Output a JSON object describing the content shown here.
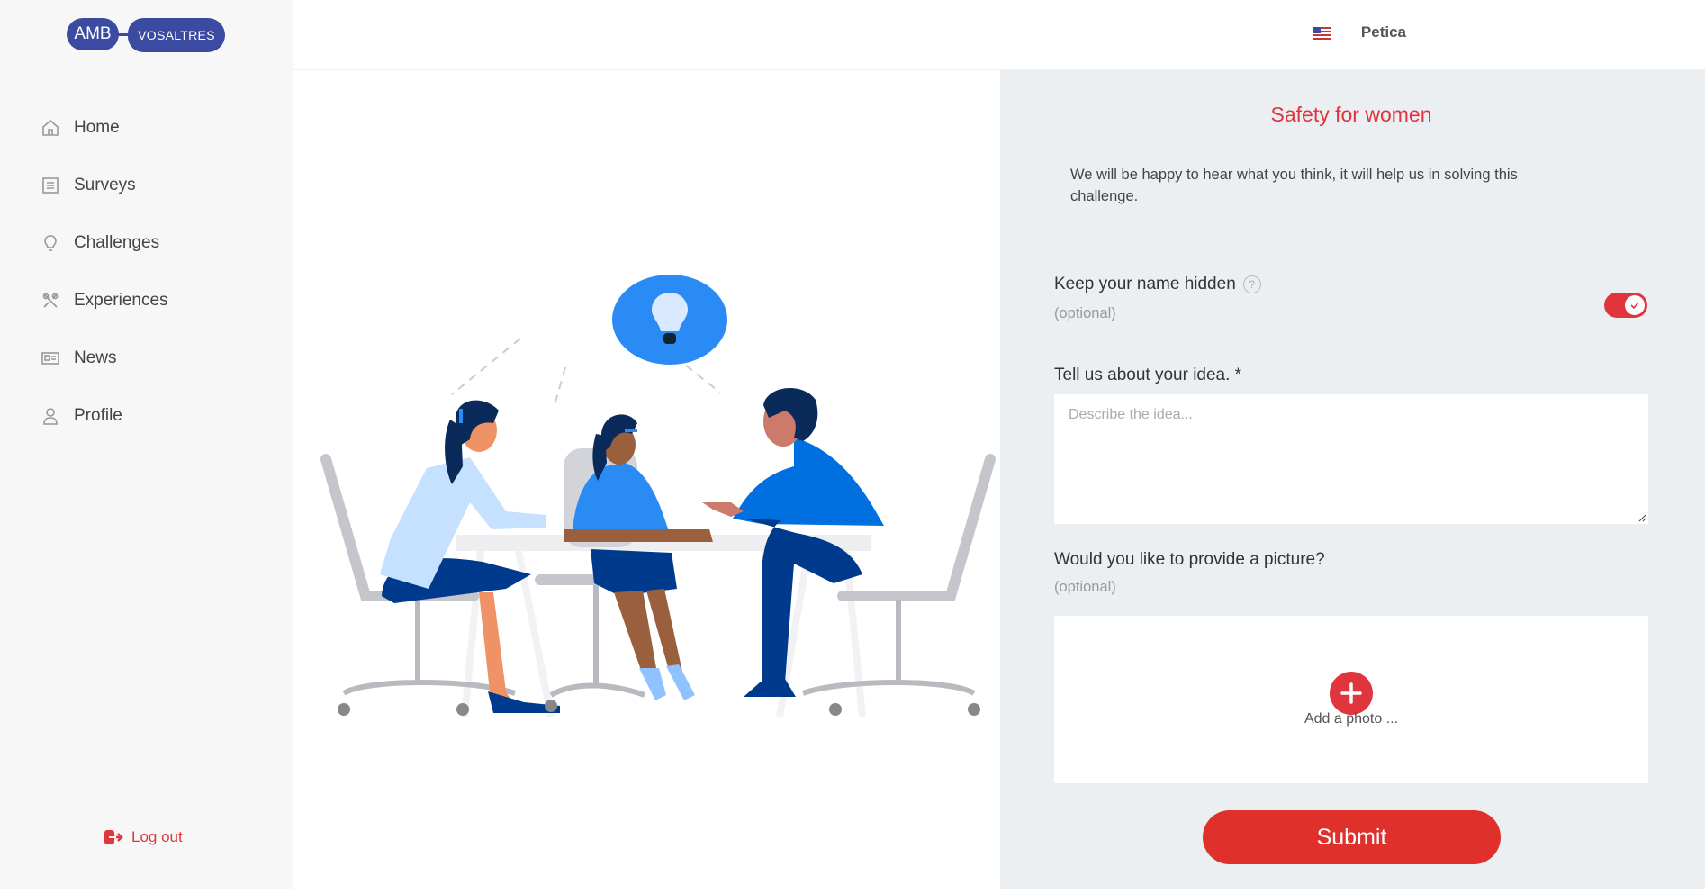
{
  "logo": {
    "part1": "AMB",
    "part2": "VOSALTRES"
  },
  "sidebar": {
    "items": [
      {
        "label": "Home",
        "icon": "home-icon"
      },
      {
        "label": "Surveys",
        "icon": "list-icon"
      },
      {
        "label": "Challenges",
        "icon": "lightbulb-icon"
      },
      {
        "label": "Experiences",
        "icon": "tools-icon"
      },
      {
        "label": "News",
        "icon": "newspaper-icon"
      },
      {
        "label": "Profile",
        "icon": "user-icon"
      }
    ],
    "logout_label": "Log out"
  },
  "header": {
    "user_name": "Petica",
    "flag_icon": "us-flag-icon"
  },
  "form": {
    "title": "Safety for women",
    "intro": "We will be happy to hear what you think, it will help us in solving this challenge.",
    "hide_name_label": "Keep your name hidden",
    "hide_name_optional": "(optional)",
    "hide_name_value": true,
    "idea_label": "Tell us about your idea. *",
    "idea_placeholder": "Describe the idea...",
    "picture_label": "Would you like to provide a picture?",
    "picture_optional": "(optional)",
    "add_photo_label": "Add a photo ...",
    "submit_label": "Submit"
  },
  "colors": {
    "accent": "#e0353d",
    "brand": "#3b4ba1",
    "panel_bg": "#eceff2"
  }
}
